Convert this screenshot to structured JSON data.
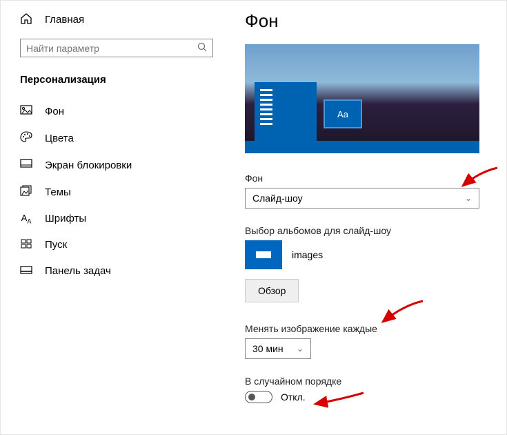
{
  "sidebar": {
    "home": "Главная",
    "search_placeholder": "Найти параметр",
    "section": "Персонализация",
    "items": [
      {
        "label": "Фон"
      },
      {
        "label": "Цвета"
      },
      {
        "label": "Экран блокировки"
      },
      {
        "label": "Темы"
      },
      {
        "label": "Шрифты"
      },
      {
        "label": "Пуск"
      },
      {
        "label": "Панель задач"
      }
    ]
  },
  "main": {
    "title": "Фон",
    "preview_sample": "Aa",
    "bg_label": "Фон",
    "bg_value": "Слайд-шоу",
    "album_label": "Выбор альбомов для слайд-шоу",
    "album_name": "images",
    "browse": "Обзор",
    "interval_label": "Менять изображение каждые",
    "interval_value": "30 мин",
    "shuffle_label": "В случайном порядке",
    "shuffle_state": "Откл."
  }
}
